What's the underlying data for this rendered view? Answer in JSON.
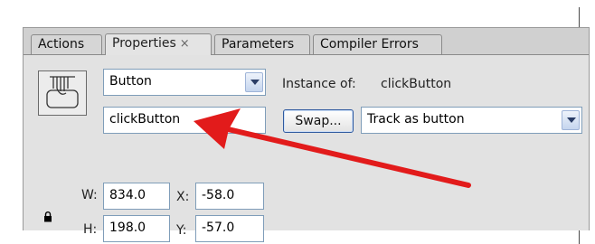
{
  "tabs": [
    {
      "label": "Actions"
    },
    {
      "label": "Properties",
      "active": true,
      "close_glyph": "×"
    },
    {
      "label": "Parameters"
    },
    {
      "label": "Compiler Errors"
    }
  ],
  "symbol": {
    "icon": "button-symbol-icon",
    "type_select": "Button",
    "instance_name": "clickButton"
  },
  "instance": {
    "label": "Instance of:",
    "value": "clickButton",
    "swap_label": "Swap...",
    "track_select": "Track as button"
  },
  "geometry": {
    "w_label": "W:",
    "w_value": "834.0",
    "h_label": "H:",
    "h_value": "198.0",
    "x_label": "X:",
    "x_value": "-58.0",
    "y_label": "Y:",
    "y_value": "-57.0",
    "lock_icon": "lock-icon"
  },
  "annotation": {
    "arrow_icon": "red-arrow-icon",
    "color": "#e21b1b"
  }
}
